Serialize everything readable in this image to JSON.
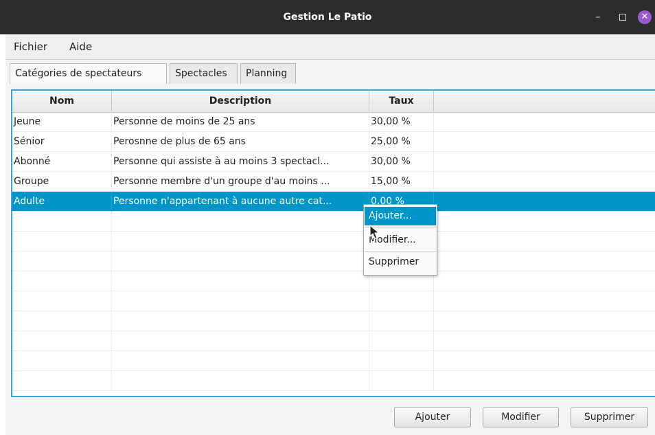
{
  "window": {
    "title": "Gestion Le Patio",
    "minimize_glyph": "–",
    "close_glyph": "✕"
  },
  "menubar": {
    "items": [
      "Fichier",
      "Aide"
    ]
  },
  "tabs": [
    {
      "label": "Catégories de spectateurs",
      "active": true
    },
    {
      "label": "Spectacles",
      "active": false
    },
    {
      "label": "Planning",
      "active": false
    }
  ],
  "table": {
    "headers": [
      "Nom",
      "Description",
      "Taux"
    ],
    "rows": [
      {
        "nom": "Jeune",
        "description": "Personne de moins de 25 ans",
        "taux": "30,00 %"
      },
      {
        "nom": "Sénior",
        "description": "Perosnne de plus de 65 ans",
        "taux": "25,00 %"
      },
      {
        "nom": "Abonné",
        "description": "Personne qui assiste à au moins 3 spectacl...",
        "taux": "30,00 %"
      },
      {
        "nom": "Groupe",
        "description": "Personne membre d'un groupe d'au moins ...",
        "taux": "15,00 %"
      },
      {
        "nom": "Adulte",
        "description": "Personne n'appartenant à aucune autre cat...",
        "taux": "0,00 %"
      }
    ],
    "selected_row": "Adulte"
  },
  "context_menu": {
    "items": [
      "Ajouter...",
      "Modifier...",
      "Supprimer"
    ],
    "highlighted": "Ajouter..."
  },
  "buttons": {
    "add": "Ajouter",
    "edit": "Modifier",
    "delete": "Supprimer"
  },
  "colors": {
    "selection": "#0096c9",
    "focus_border": "#3aa0d5",
    "close_button": "#9b59d0",
    "titlebar": "#2c2c2c"
  }
}
